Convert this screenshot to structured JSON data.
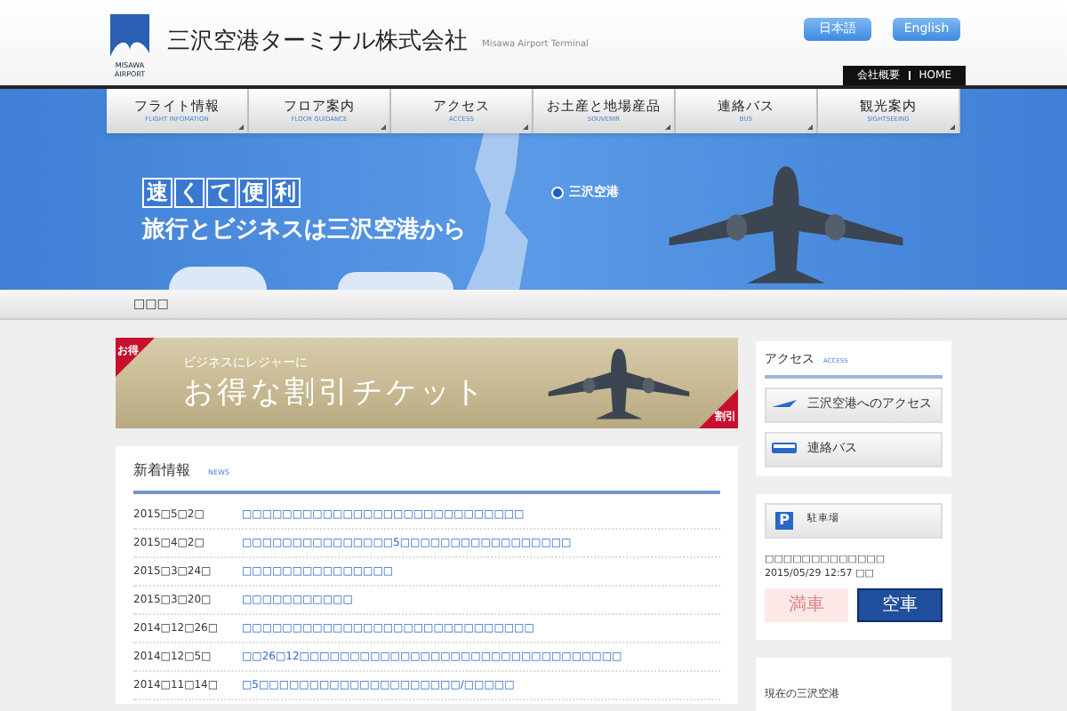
{
  "header": {
    "logo_caption": "MISAWA AIRPORT",
    "company": "三沢空港ターミナル株式会社",
    "company_en": "Misawa Airport Terminal",
    "languages": [
      {
        "label": "日本語"
      },
      {
        "label": "English"
      }
    ],
    "utility_links": [
      {
        "label": "会社概要"
      },
      {
        "label": "HOME"
      }
    ]
  },
  "nav": [
    {
      "label": "フライト情報",
      "sub": "FLIGHT INFOMATION"
    },
    {
      "label": "フロア案内",
      "sub": "FLOOR GUIDANCE"
    },
    {
      "label": "アクセス",
      "sub": "ACCESS"
    },
    {
      "label": "お土産と地場産品",
      "sub": "SOUVENIR"
    },
    {
      "label": "連絡バス",
      "sub": "BUS"
    },
    {
      "label": "観光案内",
      "sub": "SIGHTSEEING"
    }
  ],
  "hero": {
    "headline_chars": [
      "速",
      "く",
      "て",
      "便",
      "利"
    ],
    "tagline": "旅行とビジネスは三沢空港から",
    "map_label": "三沢空港"
  },
  "breadcrumb": "□□□",
  "promo": {
    "corner_left": "お得",
    "corner_right": "割引",
    "kicker": "ビジネスにレジャーに",
    "headline": "お得な割引チケット"
  },
  "news": {
    "title": "新着情報",
    "title_en": "NEWS",
    "items": [
      {
        "date": "2015□5□2□",
        "title": "□□□□□□□□□□□□□□□□□□□□□□□□□□□□"
      },
      {
        "date": "2015□4□2□",
        "title": "□□□□□□□□□□□□□□□5□□□□□□□□□□□□□□□□□"
      },
      {
        "date": "2015□3□24□",
        "title": "□□□□□□□□□□□□□□□"
      },
      {
        "date": "2015□3□20□",
        "title": "□□□□□□□□□□□"
      },
      {
        "date": "2014□12□26□",
        "title": "□□□□□□□□□□□□□□□□□□□□□□□□□□□□□"
      },
      {
        "date": "2014□12□5□",
        "title": "□□26□12□□□□□□□□□□□□□□□□□□□□□□□□□□□□□□□□"
      },
      {
        "date": "2014□11□14□",
        "title": "□5□□□□□□□□□□□□□□□□□□□□/□□□□□"
      }
    ]
  },
  "access": {
    "title": "アクセス",
    "title_en": "ACCESS",
    "links": [
      {
        "kind": "plane",
        "label": "三沢空港へのアクセス"
      },
      {
        "kind": "bus",
        "label": "連絡バス"
      }
    ]
  },
  "parking": {
    "icon_letter": "P",
    "label": "駐車場",
    "note": "□□□□□□□□□□□□□",
    "updated": "2015/05/29 12:57 □□",
    "statuses": [
      {
        "label": "満車",
        "selected": false
      },
      {
        "label": "空車",
        "selected": true
      }
    ]
  },
  "current": {
    "title": "現在の三沢空港"
  }
}
